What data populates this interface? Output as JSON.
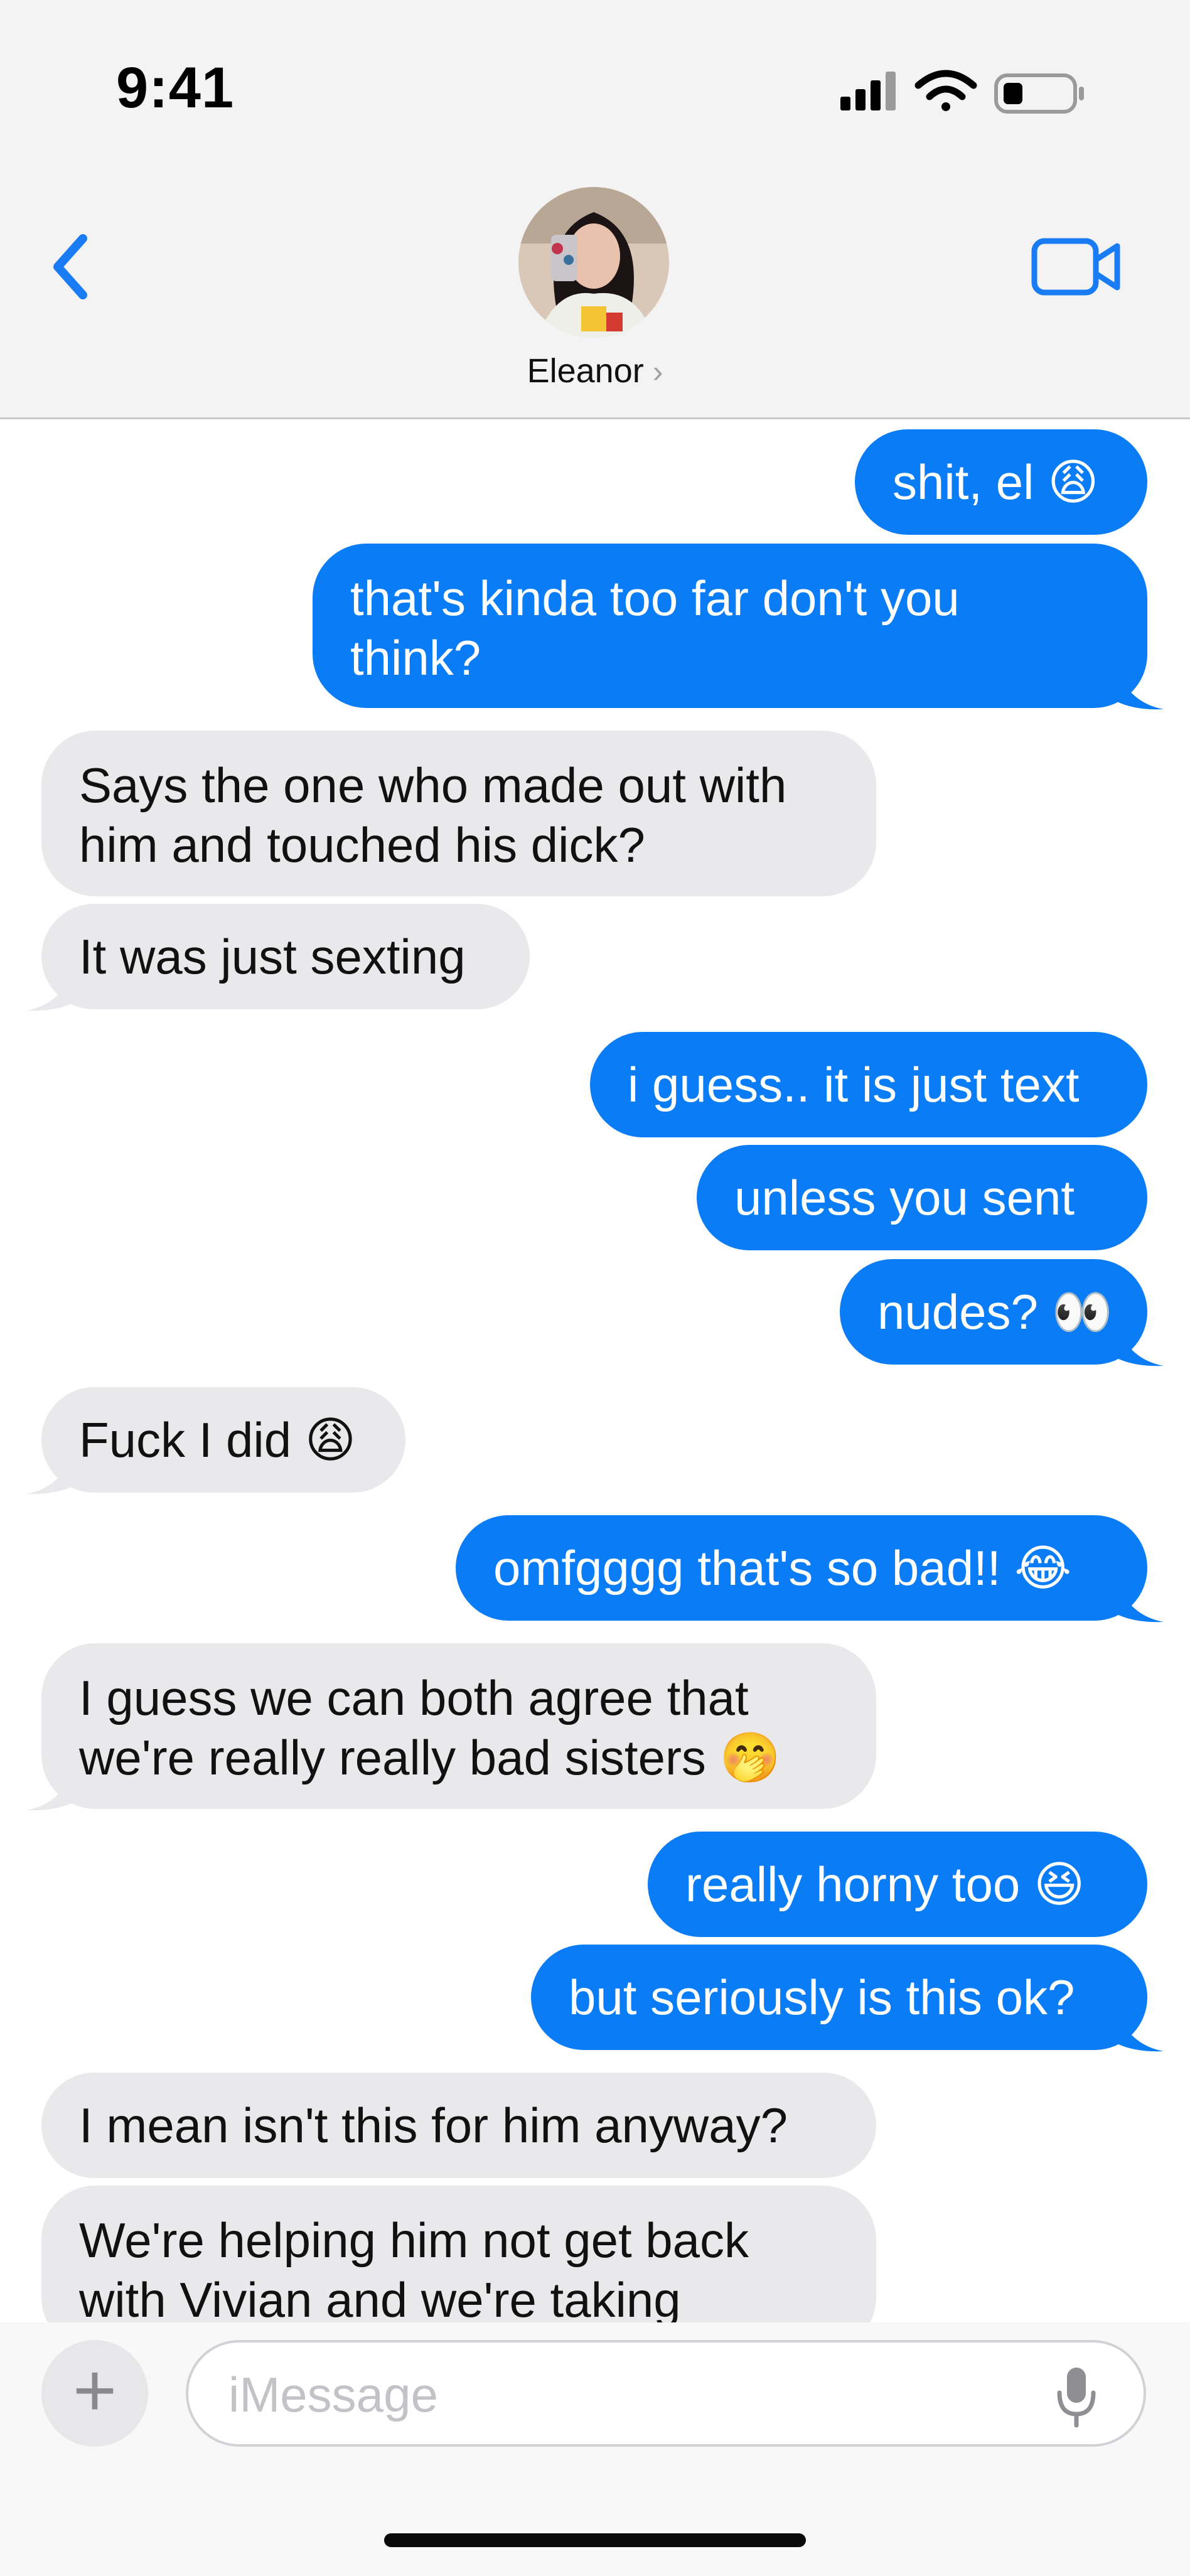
{
  "status_bar": {
    "time": "9:41"
  },
  "nav": {
    "contact_name": "Eleanor",
    "chevron": "›"
  },
  "messages": [
    {
      "dir": "out",
      "text": "shit, el 😩"
    },
    {
      "dir": "out",
      "lines": [
        "that's kinda too far don't you",
        "think?"
      ]
    },
    {
      "dir": "in",
      "lines": [
        "Says the one who made out with",
        "him and touched his dick?"
      ]
    },
    {
      "dir": "in",
      "text": "It was just sexting"
    },
    {
      "dir": "out",
      "text": "i guess.. it is just text"
    },
    {
      "dir": "out",
      "text": "unless you sent"
    },
    {
      "dir": "out",
      "text": "nudes? 👀"
    },
    {
      "dir": "in",
      "text": "Fuck I did 😩"
    },
    {
      "dir": "out",
      "text": "omfgggg that's so bad!! 😂"
    },
    {
      "dir": "in",
      "lines": [
        "I guess we can both agree that",
        "we're really really bad sisters 🤭"
      ]
    },
    {
      "dir": "out",
      "text": "really horny too 😆"
    },
    {
      "dir": "out",
      "text": "but seriously is this ok?"
    },
    {
      "dir": "in",
      "text": "I mean isn't this for him anyway?"
    },
    {
      "dir": "in",
      "lines": [
        "We're helping him not get back",
        "with Vivian and we're taking"
      ]
    }
  ],
  "composer": {
    "plus": "+",
    "placeholder": "iMessage"
  },
  "colors": {
    "outgoing_bubble": "#0a7cf6",
    "incoming_bubble": "#e9e9eb",
    "header_bg": "#f3f3f3",
    "accent": "#1a7cf5"
  },
  "icons": [
    "signal-icon",
    "wifi-icon",
    "battery-icon",
    "back-chevron-icon",
    "video-camera-icon",
    "microphone-icon"
  ]
}
